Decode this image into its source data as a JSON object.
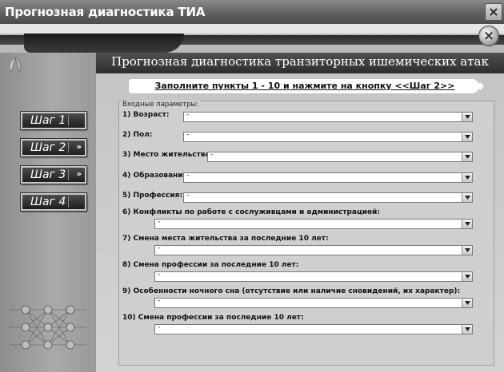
{
  "window": {
    "title": "Прогнозная диагностика ТИА",
    "close_glyph": "×"
  },
  "band": {
    "close_glyph": "×"
  },
  "header": {
    "title": "Прогнозная диагностика транзиторных ишемических атак"
  },
  "instruction": {
    "text": "Заполните пункты 1 - 10 и нажмите на кнопку <<Шаг 2>>"
  },
  "steps": [
    {
      "label": "Шаг 1",
      "arrow": ""
    },
    {
      "label": "Шаг 2",
      "arrow": "»"
    },
    {
      "label": "Шаг 3",
      "arrow": "»"
    },
    {
      "label": "Шаг 4",
      "arrow": ""
    }
  ],
  "panel": {
    "legend": "Входные параметры:",
    "fields": [
      {
        "label": "1) Возраст:",
        "value": "-"
      },
      {
        "label": "2) Пол:",
        "value": "-"
      },
      {
        "label": "3) Место жительства:",
        "value": "-"
      },
      {
        "label": "4) Образование:",
        "value": "-"
      },
      {
        "label": "5) Профессия:",
        "value": "-"
      },
      {
        "label": "6) Конфликты по работе с сослуживцами и администрацией:",
        "value": "-"
      },
      {
        "label": "7) Смена места жительства за последние 10 лет:",
        "value": "-"
      },
      {
        "label": "8) Смена профессии за последние 10 лет:",
        "value": "-"
      },
      {
        "label": "9) Особенности ночного сна (отсутствие или наличие сновидений,  их характер):",
        "value": "-"
      },
      {
        "label": "10) Смена профессии за последние 10 лет:",
        "value": "-"
      }
    ]
  },
  "icons": {
    "logo": "abstract-logo-icon",
    "network": "neural-network-icon",
    "dropdown": "chevron-down-icon"
  },
  "colors": {
    "accent_dark": "#2d2d2d",
    "background": "#d8d8d8"
  }
}
